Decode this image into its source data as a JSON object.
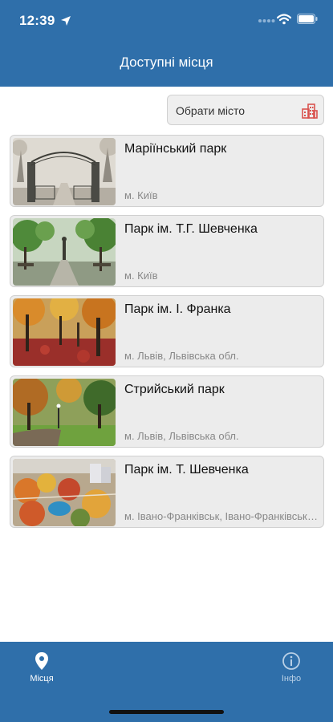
{
  "status_bar": {
    "time": "12:39"
  },
  "nav": {
    "title": "Доступні місця"
  },
  "city_button": {
    "label": "Обрати місто",
    "icon": "city-buildings-icon"
  },
  "places": [
    {
      "name": "Маріїнський парк",
      "location": "м. Київ",
      "image": "foggy-park-arch-photo"
    },
    {
      "name": "Парк ім. Т.Г. Шевченка",
      "location": "м. Київ",
      "image": "green-alley-monument-photo"
    },
    {
      "name": "Парк ім. І. Франка",
      "location": "м. Львів, Львівська обл.",
      "image": "autumn-red-leaves-photo"
    },
    {
      "name": "Стрийський парк",
      "location": "м. Львів, Львівська обл.",
      "image": "autumn-path-lawn-photo"
    },
    {
      "name": "Парк ім. Т. Шевченка",
      "location": "м. Івано-Франківськ, Івано-Франківська обл.",
      "image": "aerial-city-autumn-photo"
    }
  ],
  "tabbar": {
    "places": {
      "label": "Місця",
      "icon": "map-pin-icon"
    },
    "info": {
      "label": "Інфо",
      "icon": "info-circle-icon"
    }
  },
  "colors": {
    "primary": "#2f6faa",
    "card_bg": "#ececec",
    "city_icon": "#d9534f"
  }
}
